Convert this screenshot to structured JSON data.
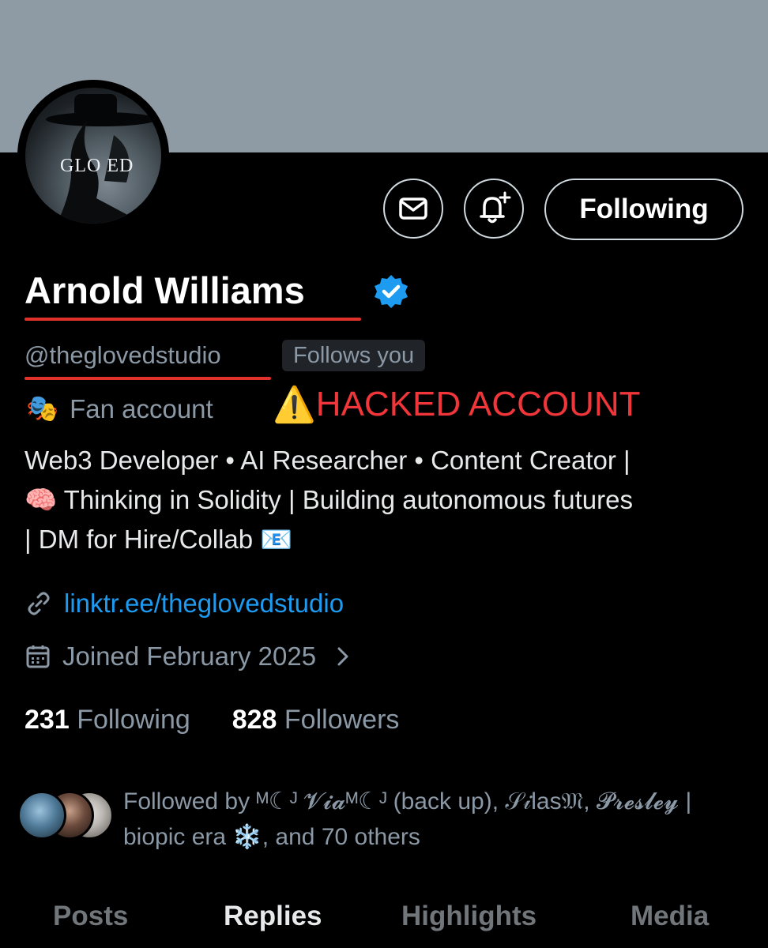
{
  "banner": {
    "color": "#8e9ba4"
  },
  "avatar": {
    "logo_text": "GLO ED",
    "icon": "gloved-studio-logo"
  },
  "actions": {
    "message_icon": "envelope-icon",
    "notify_icon": "bell-plus-icon",
    "follow_label": "Following"
  },
  "profile": {
    "name": "Arnold Williams",
    "verified": true,
    "handle": "@theglovedstudio",
    "follows_you": "Follows you",
    "category_emoji": "🎭",
    "category": "Fan account",
    "annotation_emoji": "⚠️",
    "annotation": "HACKED ACCOUNT",
    "annotation_color": "#f0363a",
    "bio_line1": "Web3 Developer • AI Researcher • Content Creator |",
    "bio_line2": "🧠 Thinking in Solidity | Building autonomous futures",
    "bio_line3": "| DM for Hire/Collab 📧",
    "link": "linktr.ee/theglovedstudio",
    "joined": "Joined February 2025"
  },
  "stats": {
    "following_count": "231",
    "following_label": "Following",
    "followers_count": "828",
    "followers_label": "Followers"
  },
  "followed_by": {
    "line1": "Followed by ᴹ☾ᴶ 𝓥𝓲𝓪ᴹ☾ᴶ (back up), 𝒮𝒾las𝔐, 𝓟𝓻𝓮𝓼𝓵𝓮𝔂 |",
    "line2": "biopic era ❄️, and 70 others"
  },
  "tabs": [
    "Posts",
    "Replies",
    "Highlights",
    "Media"
  ]
}
